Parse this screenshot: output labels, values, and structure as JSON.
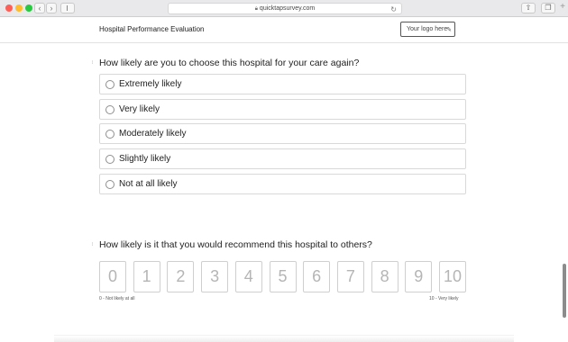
{
  "browser": {
    "url": "quicktapsurvey.com"
  },
  "header": {
    "title": "Hospital Performance Evaluation",
    "logo_label": "Your logo here"
  },
  "question1": {
    "text": "How likely are you to choose this hospital for your care again?",
    "options": [
      "Extremely likely",
      "Very likely",
      "Moderately likely",
      "Slightly likely",
      "Not at all likely"
    ]
  },
  "question2": {
    "text": "How likely is it that you would recommend this hospital to others?",
    "scale": [
      "0",
      "1",
      "2",
      "3",
      "4",
      "5",
      "6",
      "7",
      "8",
      "9",
      "10"
    ],
    "min_label": "0 - Not likely at all",
    "max_label": "10 - Very likely"
  }
}
